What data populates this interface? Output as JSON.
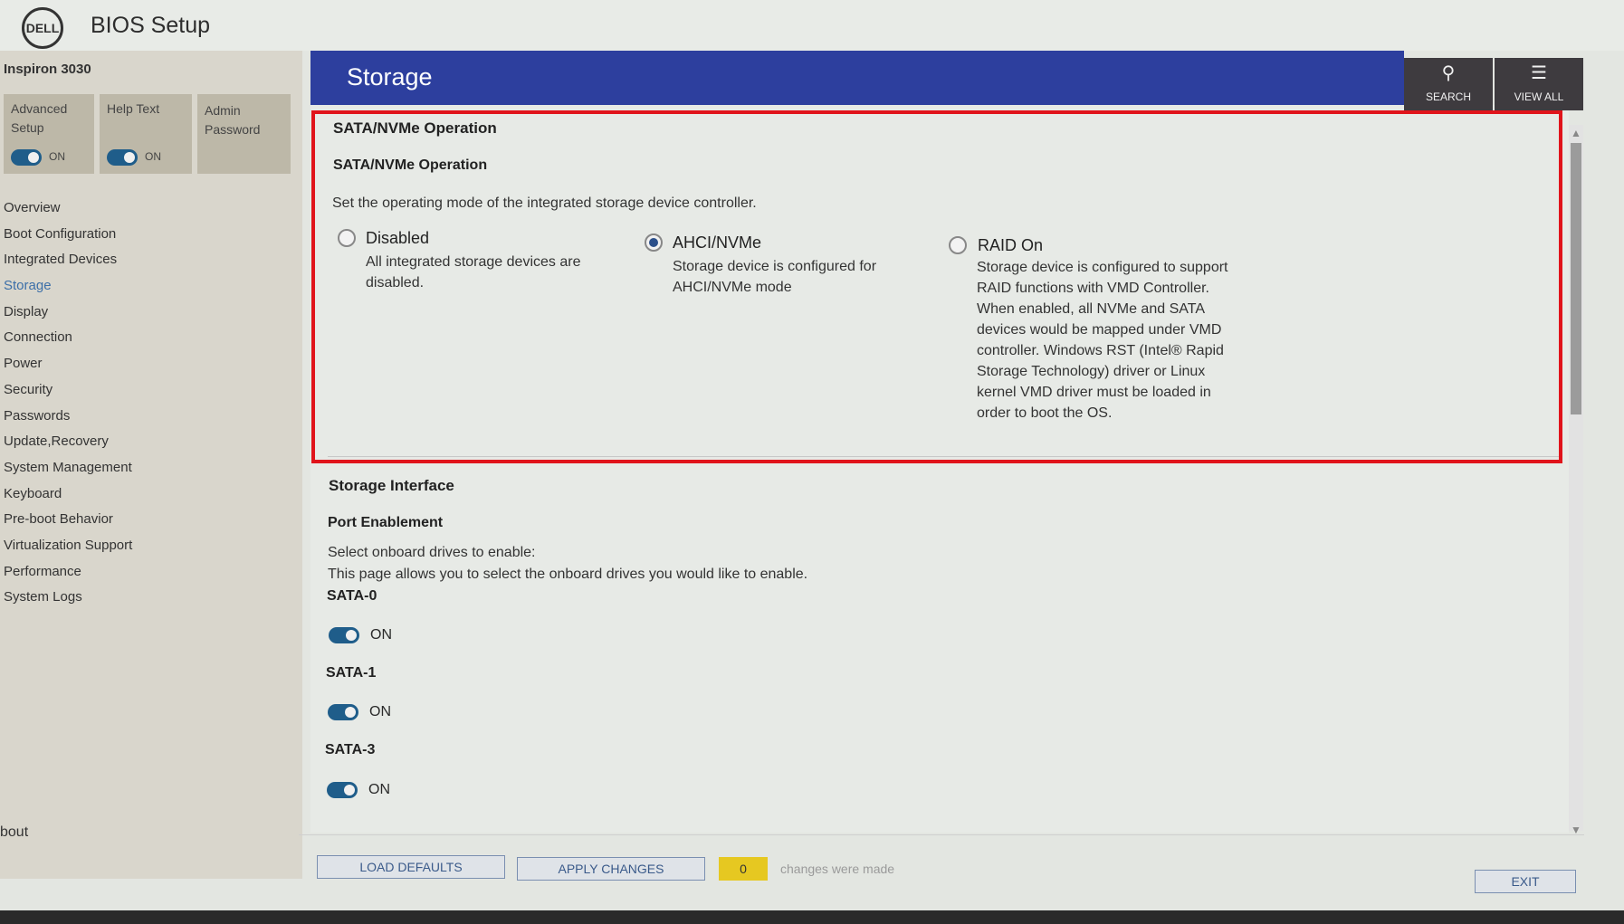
{
  "app": {
    "logo": "DELL",
    "title": "BIOS Setup"
  },
  "sidebar": {
    "model": "Inspiron 3030",
    "tiles": [
      {
        "label": "Advanced Setup",
        "toggle": "ON"
      },
      {
        "label": "Help Text",
        "toggle": "ON"
      },
      {
        "label": "Admin Password"
      }
    ],
    "nav": [
      "Overview",
      "Boot Configuration",
      "Integrated Devices",
      "Storage",
      "Display",
      "Connection",
      "Power",
      "Security",
      "Passwords",
      "Update,Recovery",
      "System Management",
      "Keyboard",
      "Pre-boot Behavior",
      "Virtualization Support",
      "Performance",
      "System Logs"
    ],
    "active": "Storage",
    "about": "bout"
  },
  "header": {
    "title": "Storage",
    "search_label": "SEARCH",
    "viewall_label": "VIEW ALL"
  },
  "sata_nvme": {
    "section_title": "SATA/NVMe Operation",
    "setting_title": "SATA/NVMe Operation",
    "description": "Set the operating mode of the integrated storage device controller.",
    "options": [
      {
        "label": "Disabled",
        "desc": [
          "All integrated storage devices are",
          "disabled."
        ],
        "selected": false
      },
      {
        "label": "AHCI/NVMe",
        "desc": [
          "Storage device is configured for",
          "AHCI/NVMe mode"
        ],
        "selected": true
      },
      {
        "label": "RAID On",
        "desc": [
          "Storage device is configured to support",
          "RAID functions with VMD Controller.",
          "When enabled, all NVMe and SATA",
          "devices would be mapped under VMD",
          "controller. Windows RST (Intel® Rapid",
          "Storage Technology) driver or Linux",
          "kernel VMD driver must be loaded in",
          "order to boot the OS."
        ],
        "selected": false
      }
    ]
  },
  "storage_interface": {
    "section_title": "Storage Interface",
    "setting_title": "Port Enablement",
    "desc1": "Select onboard drives to enable:",
    "desc2": "This page allows you to select the onboard drives you would like to enable.",
    "ports": [
      {
        "name": "SATA-0",
        "state": "ON"
      },
      {
        "name": "SATA-1",
        "state": "ON"
      },
      {
        "name": "SATA-3",
        "state": "ON"
      }
    ]
  },
  "footer": {
    "load_defaults": "LOAD DEFAULTS",
    "apply_changes": "APPLY CHANGES",
    "changes_count": "0",
    "changes_text": "changes were made",
    "exit": "EXIT"
  },
  "colors": {
    "header_blue": "#2d3f9e",
    "highlight_red": "#e0141b",
    "toggle_blue": "#1f5d8a",
    "count_yellow": "#e6c821"
  }
}
